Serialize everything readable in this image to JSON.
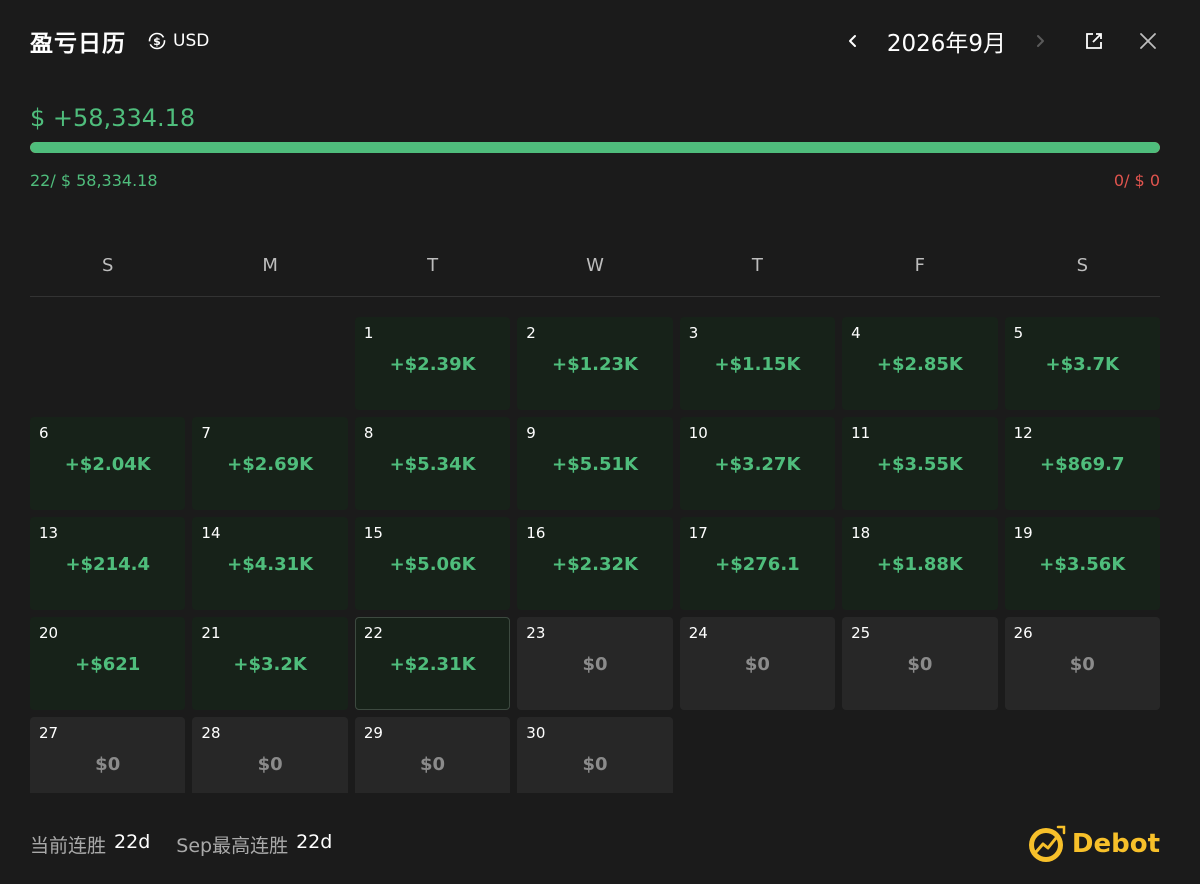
{
  "header": {
    "title": "盈亏日历",
    "currency": "USD",
    "month": "2026年9月"
  },
  "summary": {
    "total": "$ +58,334.18",
    "win_stats": "22/ $ 58,334.18",
    "loss_stats": "0/ $ 0",
    "win_ratio": 1.0
  },
  "weekdays": [
    "S",
    "M",
    "T",
    "W",
    "T",
    "F",
    "S"
  ],
  "calendar": {
    "leading_blanks": 2,
    "days": [
      {
        "day": "1",
        "value": "+$2.39K",
        "type": "profit"
      },
      {
        "day": "2",
        "value": "+$1.23K",
        "type": "profit"
      },
      {
        "day": "3",
        "value": "+$1.15K",
        "type": "profit"
      },
      {
        "day": "4",
        "value": "+$2.85K",
        "type": "profit"
      },
      {
        "day": "5",
        "value": "+$3.7K",
        "type": "profit"
      },
      {
        "day": "6",
        "value": "+$2.04K",
        "type": "profit"
      },
      {
        "day": "7",
        "value": "+$2.69K",
        "type": "profit"
      },
      {
        "day": "8",
        "value": "+$5.34K",
        "type": "profit"
      },
      {
        "day": "9",
        "value": "+$5.51K",
        "type": "profit"
      },
      {
        "day": "10",
        "value": "+$3.27K",
        "type": "profit"
      },
      {
        "day": "11",
        "value": "+$3.55K",
        "type": "profit"
      },
      {
        "day": "12",
        "value": "+$869.7",
        "type": "profit"
      },
      {
        "day": "13",
        "value": "+$214.4",
        "type": "profit"
      },
      {
        "day": "14",
        "value": "+$4.31K",
        "type": "profit"
      },
      {
        "day": "15",
        "value": "+$5.06K",
        "type": "profit"
      },
      {
        "day": "16",
        "value": "+$2.32K",
        "type": "profit"
      },
      {
        "day": "17",
        "value": "+$276.1",
        "type": "profit"
      },
      {
        "day": "18",
        "value": "+$1.88K",
        "type": "profit"
      },
      {
        "day": "19",
        "value": "+$3.56K",
        "type": "profit"
      },
      {
        "day": "20",
        "value": "+$621",
        "type": "profit"
      },
      {
        "day": "21",
        "value": "+$3.2K",
        "type": "profit"
      },
      {
        "day": "22",
        "value": "+$2.31K",
        "type": "profit",
        "today": true
      },
      {
        "day": "23",
        "value": "$0",
        "type": "zero"
      },
      {
        "day": "24",
        "value": "$0",
        "type": "zero"
      },
      {
        "day": "25",
        "value": "$0",
        "type": "zero"
      },
      {
        "day": "26",
        "value": "$0",
        "type": "zero"
      },
      {
        "day": "27",
        "value": "$0",
        "type": "zero"
      },
      {
        "day": "28",
        "value": "$0",
        "type": "zero"
      },
      {
        "day": "29",
        "value": "$0",
        "type": "zero"
      },
      {
        "day": "30",
        "value": "$0",
        "type": "zero"
      }
    ]
  },
  "footer": {
    "current_streak_label": "当前连胜",
    "current_streak_value": "22d",
    "max_streak_label": "Sep最高连胜",
    "max_streak_value": "22d"
  },
  "brand": {
    "name": "Debot",
    "logo_icon": "debot-logo-icon"
  },
  "icons": {
    "currency": "dollar-cycle-icon",
    "prev": "chevron-left-icon",
    "next": "chevron-right-icon",
    "external": "external-link-icon",
    "close": "close-icon"
  },
  "colors": {
    "profit": "#4fbd7c",
    "loss": "#e0544e",
    "brand": "#f7c02a",
    "background": "#1b1b1b"
  }
}
